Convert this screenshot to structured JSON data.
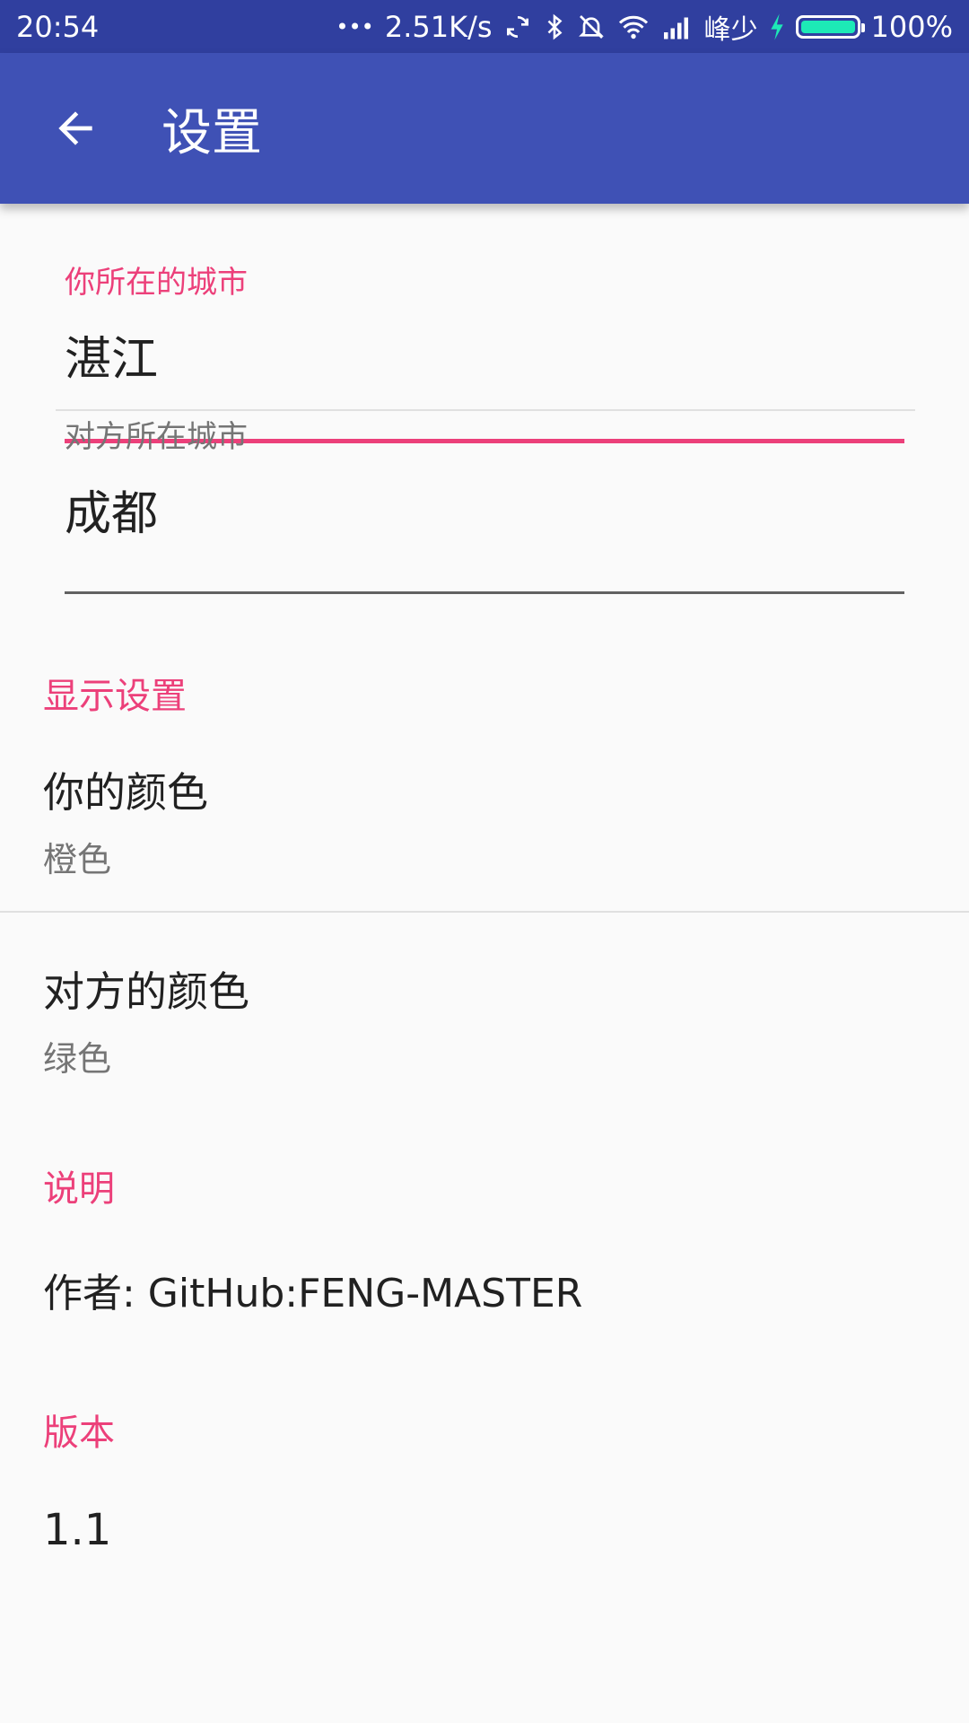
{
  "status_bar": {
    "time": "20:54",
    "dots": "•••",
    "speed": "2.51K/s",
    "carrier": "峰少",
    "battery": "100%",
    "battery_level": 1.0
  },
  "app_bar": {
    "title": "设置"
  },
  "city": {
    "your_label": "你所在的城市",
    "your_value": "湛江",
    "other_label": "对方所在城市",
    "other_value": "成都"
  },
  "display": {
    "section": "显示设置",
    "your_color_title": "你的颜色",
    "your_color_value": "橙色",
    "other_color_title": "对方的颜色",
    "other_color_value": "绿色"
  },
  "about": {
    "section": "说明",
    "author": "作者:   GitHub:FENG-MASTER"
  },
  "version": {
    "section": "版本",
    "value": "1.1"
  },
  "colors": {
    "accent": "#ec407a",
    "primary": "#3f51b5",
    "primary_dark": "#303f9f",
    "battery": "#1de9b6"
  }
}
